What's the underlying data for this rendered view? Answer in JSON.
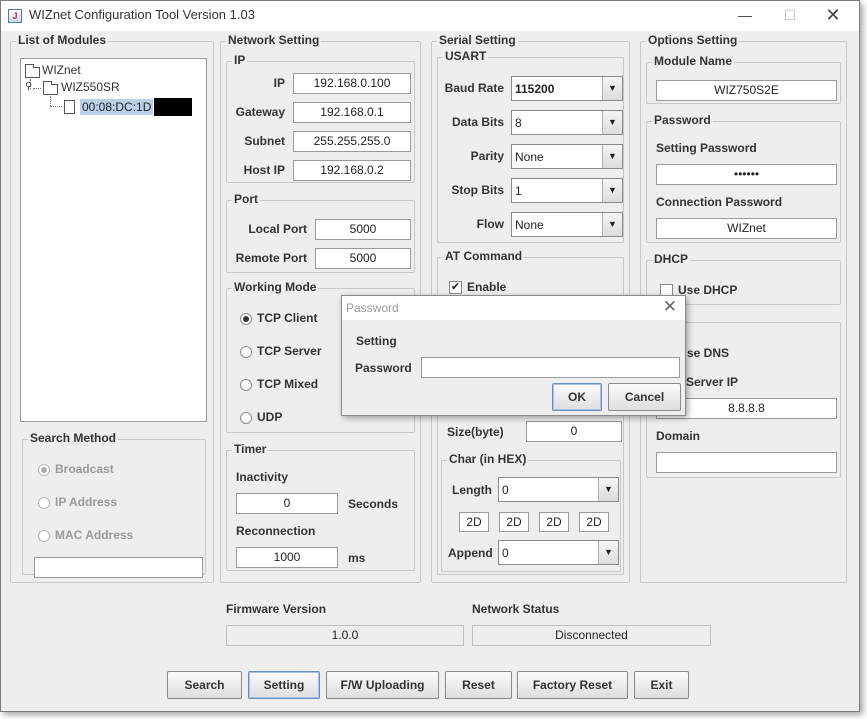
{
  "window": {
    "title": "WIZnet Configuration Tool Version 1.03",
    "app_icon_glyph": "J",
    "minimize_glyph": "—",
    "maximize_glyph": "☐",
    "close_glyph": "✕"
  },
  "modules": {
    "title": "List of Modules",
    "tree_root": "WIZnet",
    "tree_child": "WIZ550SR",
    "tree_leaf": "00:08:DC:1D",
    "expand_glyph": "⚲"
  },
  "search_method": {
    "title": "Search Method",
    "broadcast": "Broadcast",
    "ip_address": "IP Address",
    "mac_address": "MAC Address",
    "input_value": ""
  },
  "network": {
    "title": "Network Setting",
    "ip_group": "IP",
    "ip_label": "IP",
    "ip_value": "192.168.0.100",
    "gateway_label": "Gateway",
    "gateway_value": "192.168.0.1",
    "subnet_label": "Subnet",
    "subnet_value": "255.255.255.0",
    "hostip_label": "Host IP",
    "hostip_value": "192.168.0.2",
    "port_group": "Port",
    "local_port_label": "Local Port",
    "local_port_value": "5000",
    "remote_port_label": "Remote Port",
    "remote_port_value": "5000",
    "mode_group": "Working Mode",
    "mode_tcp_client": "TCP Client",
    "mode_tcp_server": "TCP Server",
    "mode_tcp_mixed": "TCP Mixed",
    "mode_udp": "UDP",
    "timer_group": "Timer",
    "inactivity_label": "Inactivity",
    "inactivity_value": "0",
    "seconds_label": "Seconds",
    "reconnection_label": "Reconnection",
    "reconnection_value": "1000",
    "ms_label": "ms"
  },
  "serial": {
    "title": "Serial Setting",
    "usart_group": "USART",
    "baud_label": "Baud Rate",
    "baud_value": "115200",
    "databits_label": "Data Bits",
    "databits_value": "8",
    "parity_label": "Parity",
    "parity_value": "None",
    "stopbits_label": "Stop Bits",
    "stopbits_value": "1",
    "flow_label": "Flow",
    "flow_value": "None",
    "at_group": "AT Command",
    "at_enable_label": "Enable",
    "check_glyph": "✔",
    "size_label": "Size(byte)",
    "size_value": "0",
    "char_group": "Char (in HEX)",
    "length_label": "Length",
    "length_value": "0",
    "hex_values": [
      "2D",
      "2D",
      "2D",
      "2D"
    ],
    "append_label": "Append",
    "append_value": "0",
    "dropdown_glyph": "▼"
  },
  "options": {
    "title": "Options Setting",
    "module_name_group": "Module Name",
    "module_name_value": "WIZ750S2E",
    "password_group": "Password",
    "setting_password_label": "Setting Password",
    "setting_password_value": "••••••",
    "connection_password_label": "Connection Password",
    "connection_password_value": "WIZnet",
    "dhcp_group": "DHCP",
    "use_dhcp_label": "Use DHCP",
    "use_dns_label": "se DNS",
    "dns_server_label": "Server IP",
    "dns_server_value": "8.8.8.8",
    "domain_label": "Domain",
    "domain_value": ""
  },
  "status": {
    "firmware_label": "Firmware Version",
    "firmware_value": "1.0.0",
    "network_label": "Network Status",
    "network_value": "Disconnected"
  },
  "buttons": {
    "search": "Search",
    "setting": "Setting",
    "fw_uploading": "F/W Uploading",
    "reset": "Reset",
    "factory_reset": "Factory Reset",
    "exit": "Exit"
  },
  "dialog": {
    "title": "Password",
    "close_glyph": "✕",
    "line1": "Setting",
    "line2": "Password",
    "input_value": "",
    "ok": "OK",
    "cancel": "Cancel"
  }
}
